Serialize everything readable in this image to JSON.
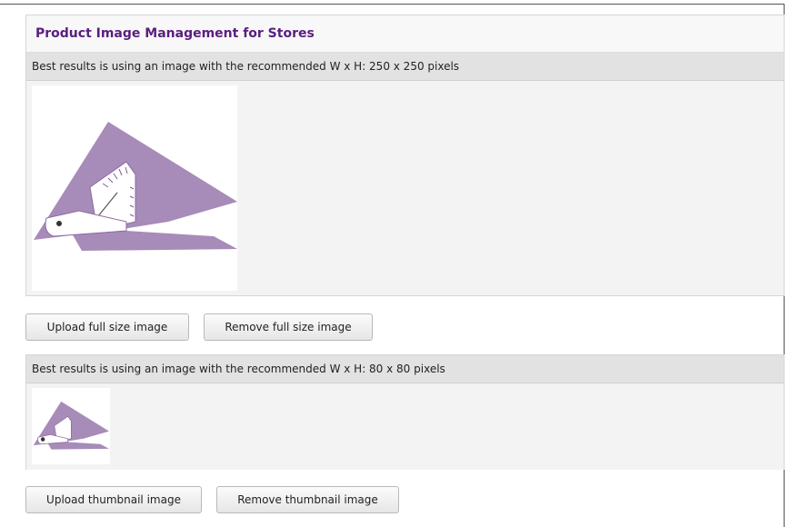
{
  "panel": {
    "title": "Product Image Management for Stores"
  },
  "full_size": {
    "hint": "Best results is using an image with the recommended W x H: 250 x 250 pixels",
    "upload_label": "Upload full size image",
    "remove_label": "Remove full size image"
  },
  "thumbnail": {
    "hint": "Best results is using an image with the recommended W x H: 80 x 80 pixels",
    "upload_label": "Upload thumbnail image",
    "remove_label": "Remove thumbnail image"
  },
  "colors": {
    "title": "#5a1e7e",
    "product": "#a78bb8",
    "product_dark": "#8c6aa3"
  }
}
